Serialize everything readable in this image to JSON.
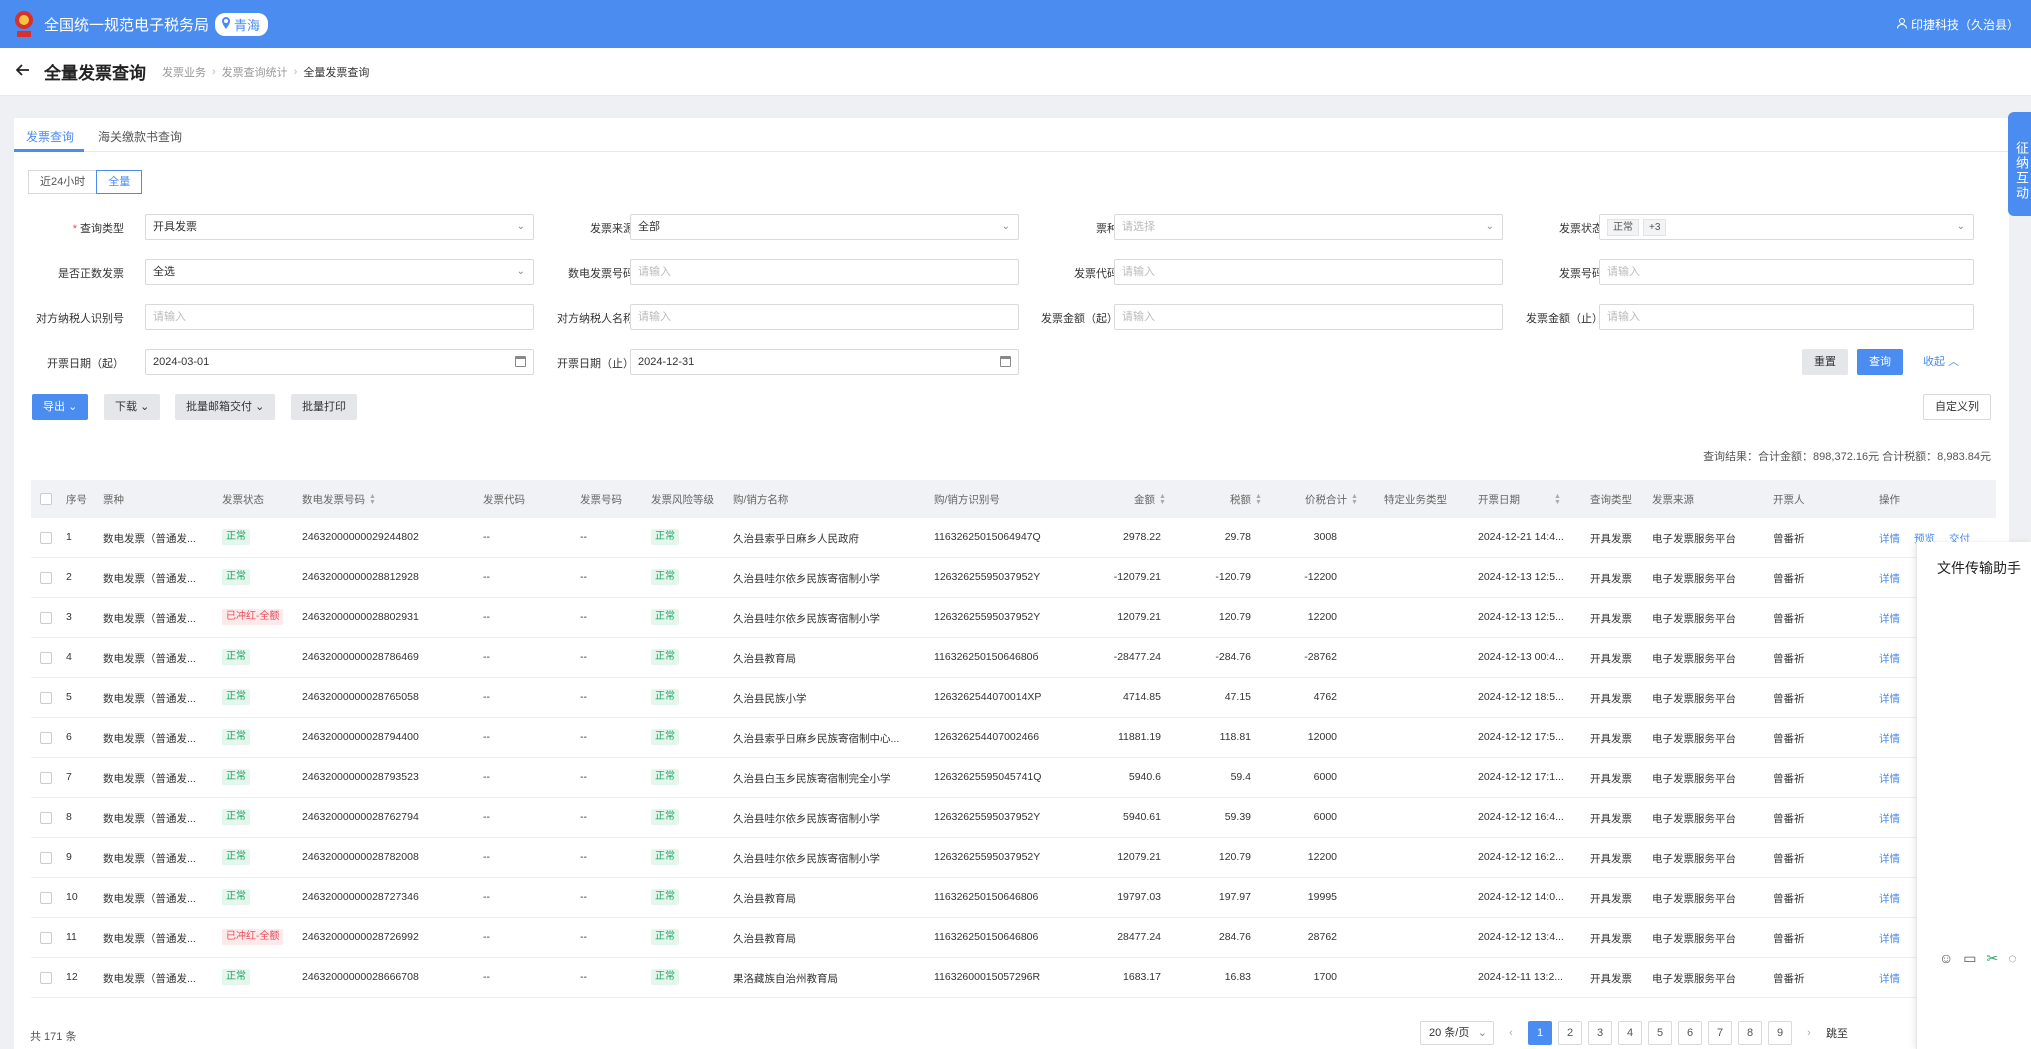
{
  "app": {
    "title": "全国统一规范电子税务局",
    "region": "青海",
    "user": "印捷科技（久治县）"
  },
  "page": {
    "title": "全量发票查询",
    "breadcrumb": [
      "发票业务",
      "发票查询统计",
      "全量发票查询"
    ]
  },
  "tabs": [
    "发票查询",
    "海关缴款书查询"
  ],
  "range": {
    "opt1": "近24小时",
    "opt2": "全量"
  },
  "form": {
    "query_type": {
      "label": "查询类型",
      "value": "开具发票"
    },
    "source": {
      "label": "发票来源",
      "value": "全部"
    },
    "kind": {
      "label": "票种",
      "placeholder": "请选择"
    },
    "status": {
      "label": "发票状态",
      "tag1": "正常",
      "tag2": "+3"
    },
    "is_positive": {
      "label": "是否正数发票",
      "value": "全选"
    },
    "digital_no": {
      "label": "数电发票号码",
      "placeholder": "请输入"
    },
    "code": {
      "label": "发票代码",
      "placeholder": "请输入"
    },
    "number": {
      "label": "发票号码",
      "placeholder": "请输入"
    },
    "party_id": {
      "label": "对方纳税人识别号",
      "placeholder": "请输入"
    },
    "party_name": {
      "label": "对方纳税人名称",
      "placeholder": "请输入"
    },
    "amount_from": {
      "label": "发票金额（起）",
      "placeholder": "请输入"
    },
    "amount_to": {
      "label": "发票金额（止）",
      "placeholder": "请输入"
    },
    "date_from": {
      "label": "开票日期（起）",
      "value": "2024-03-01"
    },
    "date_to": {
      "label": "开票日期（止）",
      "value": "2024-12-31"
    },
    "reset": "重置",
    "search": "查询",
    "collapse": "收起"
  },
  "toolbar": {
    "export": "导出",
    "download": "下载",
    "mail": "批量邮箱交付",
    "print": "批量打印",
    "custom": "自定义列"
  },
  "summary": "查询结果：合计金额：898,372.16元   合计税额：8,983.84元",
  "columns": [
    "序号",
    "票种",
    "发票状态",
    "数电发票号码",
    "发票代码",
    "发票号码",
    "发票风险等级",
    "购/销方名称",
    "购/销方识别号",
    "金额",
    "税额",
    "价税合计",
    "特定业务类型",
    "开票日期",
    "查询类型",
    "发票来源",
    "开票人",
    "操作"
  ],
  "rows": [
    {
      "no": "1",
      "kind": "数电发票（普通发...",
      "status": "正常",
      "status_type": "ok",
      "digital": "24632000000029244802",
      "code": "--",
      "num": "--",
      "risk": "正常",
      "name": "久治县索乎日麻乡人民政府",
      "id": "11632625015064947Q",
      "amount": "2978.22",
      "tax": "29.78",
      "total": "3008",
      "date": "2024-12-21 14:4...",
      "qtype": "开具发票",
      "source": "电子发票服务平台",
      "issuer": "曾番祈",
      "op1": "详情",
      "op2": "预览",
      "op3": "交付"
    },
    {
      "no": "2",
      "kind": "数电发票（普通发...",
      "status": "正常",
      "status_type": "ok",
      "digital": "24632000000028812928",
      "code": "--",
      "num": "--",
      "risk": "正常",
      "name": "久治县哇尔依乡民族寄宿制小学",
      "id": "12632625595037952Y",
      "amount": "-12079.21",
      "tax": "-120.79",
      "total": "-12200",
      "date": "2024-12-13 12:5...",
      "qtype": "开具发票",
      "source": "电子发票服务平台",
      "issuer": "曾番祈",
      "op1": "详情"
    },
    {
      "no": "3",
      "kind": "数电发票（普通发...",
      "status": "已冲红-全额",
      "status_type": "red",
      "digital": "24632000000028802931",
      "code": "--",
      "num": "--",
      "risk": "正常",
      "name": "久治县哇尔依乡民族寄宿制小学",
      "id": "12632625595037952Y",
      "amount": "12079.21",
      "tax": "120.79",
      "total": "12200",
      "date": "2024-12-13 12:5...",
      "qtype": "开具发票",
      "source": "电子发票服务平台",
      "issuer": "曾番祈",
      "op1": "详情"
    },
    {
      "no": "4",
      "kind": "数电发票（普通发...",
      "status": "正常",
      "status_type": "ok",
      "digital": "24632000000028786469",
      "code": "--",
      "num": "--",
      "risk": "正常",
      "name": "久治县教育局",
      "id": "11632625015064680б",
      "amount": "-28477.24",
      "tax": "-284.76",
      "total": "-28762",
      "date": "2024-12-13 00:4...",
      "qtype": "开具发票",
      "source": "电子发票服务平台",
      "issuer": "曾番祈",
      "op1": "详情"
    },
    {
      "no": "5",
      "kind": "数电发票（普通发...",
      "status": "正常",
      "status_type": "ok",
      "digital": "24632000000028765058",
      "code": "--",
      "num": "--",
      "risk": "正常",
      "name": "久治县民族小学",
      "id": "1263262544070014XP",
      "amount": "4714.85",
      "tax": "47.15",
      "total": "4762",
      "date": "2024-12-12 18:5...",
      "qtype": "开具发票",
      "source": "电子发票服务平台",
      "issuer": "曾番祈",
      "op1": "详情"
    },
    {
      "no": "6",
      "kind": "数电发票（普通发...",
      "status": "正常",
      "status_type": "ok",
      "digital": "24632000000028794400",
      "code": "--",
      "num": "--",
      "risk": "正常",
      "name": "久治县索乎日麻乡民族寄宿制中心...",
      "id": "126326254407002466",
      "amount": "11881.19",
      "tax": "118.81",
      "total": "12000",
      "date": "2024-12-12 17:5...",
      "qtype": "开具发票",
      "source": "电子发票服务平台",
      "issuer": "曾番祈",
      "op1": "详情"
    },
    {
      "no": "7",
      "kind": "数电发票（普通发...",
      "status": "正常",
      "status_type": "ok",
      "digital": "24632000000028793523",
      "code": "--",
      "num": "--",
      "risk": "正常",
      "name": "久治县白玉乡民族寄宿制完全小学",
      "id": "12632625595045741Q",
      "amount": "5940.6",
      "tax": "59.4",
      "total": "6000",
      "date": "2024-12-12 17:1...",
      "qtype": "开具发票",
      "source": "电子发票服务平台",
      "issuer": "曾番祈",
      "op1": "详情"
    },
    {
      "no": "8",
      "kind": "数电发票（普通发...",
      "status": "正常",
      "status_type": "ok",
      "digital": "24632000000028762794",
      "code": "--",
      "num": "--",
      "risk": "正常",
      "name": "久治县哇尔依乡民族寄宿制小学",
      "id": "12632625595037952Y",
      "amount": "5940.61",
      "tax": "59.39",
      "total": "6000",
      "date": "2024-12-12 16:4...",
      "qtype": "开具发票",
      "source": "电子发票服务平台",
      "issuer": "曾番祈",
      "op1": "详情"
    },
    {
      "no": "9",
      "kind": "数电发票（普通发...",
      "status": "正常",
      "status_type": "ok",
      "digital": "24632000000028782008",
      "code": "--",
      "num": "--",
      "risk": "正常",
      "name": "久治县哇尔依乡民族寄宿制小学",
      "id": "12632625595037952Y",
      "amount": "12079.21",
      "tax": "120.79",
      "total": "12200",
      "date": "2024-12-12 16:2...",
      "qtype": "开具发票",
      "source": "电子发票服务平台",
      "issuer": "曾番祈",
      "op1": "详情"
    },
    {
      "no": "10",
      "kind": "数电发票（普通发...",
      "status": "正常",
      "status_type": "ok",
      "digital": "24632000000028727346",
      "code": "--",
      "num": "--",
      "risk": "正常",
      "name": "久治县教育局",
      "id": "116326250150646806",
      "amount": "19797.03",
      "tax": "197.97",
      "total": "19995",
      "date": "2024-12-12 14:0...",
      "qtype": "开具发票",
      "source": "电子发票服务平台",
      "issuer": "曾番祈",
      "op1": "详情"
    },
    {
      "no": "11",
      "kind": "数电发票（普通发...",
      "status": "已冲红-全额",
      "status_type": "red",
      "digital": "24632000000028726992",
      "code": "--",
      "num": "--",
      "risk": "正常",
      "name": "久治县教育局",
      "id": "116326250150646806",
      "amount": "28477.24",
      "tax": "284.76",
      "total": "28762",
      "date": "2024-12-12 13:4...",
      "qtype": "开具发票",
      "source": "电子发票服务平台",
      "issuer": "曾番祈",
      "op1": "详情"
    },
    {
      "no": "12",
      "kind": "数电发票（普通发...",
      "status": "正常",
      "status_type": "ok",
      "digital": "24632000000028666708",
      "code": "--",
      "num": "--",
      "risk": "正常",
      "name": "果洛藏族自治州教育局",
      "id": "11632600015057296R",
      "amount": "1683.17",
      "tax": "16.83",
      "total": "1700",
      "date": "2024-12-11 13:2...",
      "qtype": "开具发票",
      "source": "电子发票服务平台",
      "issuer": "曾番祈",
      "op1": "详情"
    }
  ],
  "footer": {
    "total": "共 171 条",
    "page_size": "20 条/页",
    "pages": [
      "1",
      "2",
      "3",
      "4",
      "5",
      "6",
      "7",
      "8",
      "9"
    ],
    "jump": "跳至"
  },
  "widgets": {
    "float_tab": "征纳互动",
    "panel_title": "文件传输助手"
  },
  "colors": {
    "primary": "#4a8cf0",
    "ok": "#21a366",
    "red": "#e34d59"
  }
}
